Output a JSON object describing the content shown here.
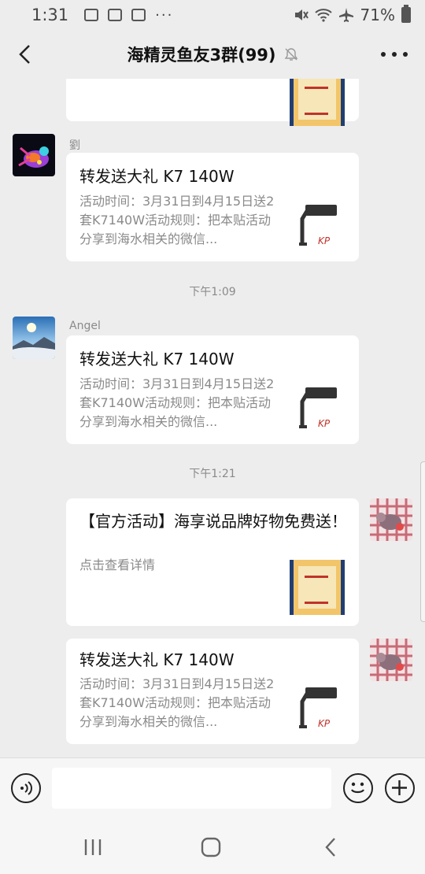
{
  "status_bar": {
    "time": "1:31",
    "dots": "···",
    "battery": "71%"
  },
  "header": {
    "title": "海精灵鱼友3群(99)"
  },
  "messages": [
    {
      "sender": "劉",
      "card_title": "转发送大礼 K7 140W",
      "card_desc": "活动时间：3月31日到4月15日送2套K7140W活动规则：把本贴活动分享到海水相关的微信..."
    },
    {
      "sender": "Angel",
      "card_title": "转发送大礼 K7 140W",
      "card_desc": "活动时间：3月31日到4月15日送2套K7140W活动规则：把本贴活动分享到海水相关的微信..."
    },
    {
      "card_title": "【官方活动】海享说品牌好物免费送！",
      "card_desc": "点击查看详情"
    },
    {
      "card_title": "转发送大礼 K7 140W",
      "card_desc": "活动时间：3月31日到4月15日送2套K7140W活动规则：把本贴活动分享到海水相关的微信..."
    }
  ],
  "times": [
    "下午1:09",
    "下午1:21"
  ],
  "input": {
    "value": ""
  },
  "icons": {
    "back": "chevron-left-icon",
    "mute": "bell-off-icon",
    "more": "more-dots-icon",
    "voice": "voice-icon",
    "emoji": "emoji-icon",
    "plus": "plus-icon",
    "nav_recents": "recents-icon",
    "nav_home": "home-icon",
    "nav_back": "nav-back-icon"
  },
  "colors": {
    "background": "#ededed",
    "card": "#ffffff",
    "muted_text": "#8a8a8a"
  }
}
